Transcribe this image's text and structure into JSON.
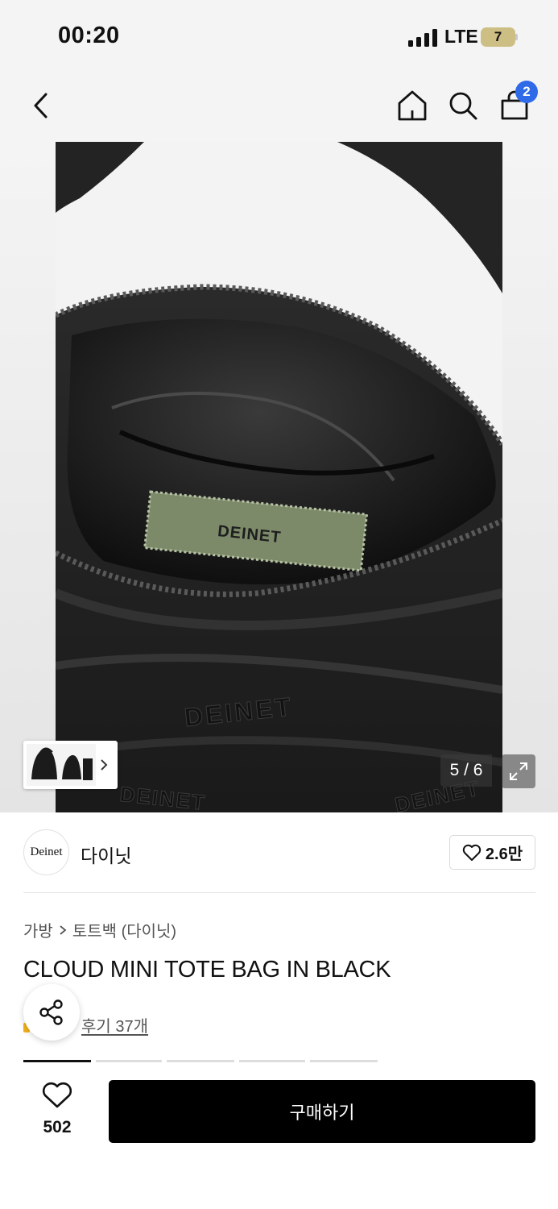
{
  "status_bar": {
    "time": "00:20",
    "network": "LTE",
    "battery": "7"
  },
  "nav": {
    "cart_count": "2"
  },
  "gallery": {
    "counter": "5 / 6",
    "label_text": "DEINET",
    "embroidery_text": "DEINET"
  },
  "brand": {
    "logo_text": "Deinet",
    "name": "다이닛",
    "likes": "2.6만"
  },
  "breadcrumb": {
    "category": "가방",
    "subcategory": "토트백 (다이닛)"
  },
  "product": {
    "title": "CLOUD MINI TOTE BAG IN BLACK",
    "reviews": "후기 37개"
  },
  "bottom_bar": {
    "wish_count": "502",
    "buy_label": "구매하기"
  },
  "colors": {
    "accent": "#2f6ae8",
    "buy_button": "#000000",
    "battery": "#cdbf84"
  }
}
